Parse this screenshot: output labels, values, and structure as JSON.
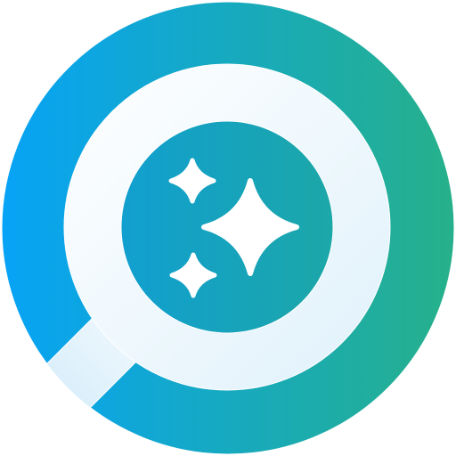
{
  "icon": {
    "name": "magnifier-sparkle-icon",
    "colors": {
      "gradient_start": "#07a3f6",
      "gradient_end": "#26b08a",
      "ring_light": "#ffffff",
      "ring_light_tint": "#dff1fb",
      "lens_start": "#119fd0",
      "lens_end": "#1ca7a8",
      "sparkle": "#ffffff"
    }
  }
}
